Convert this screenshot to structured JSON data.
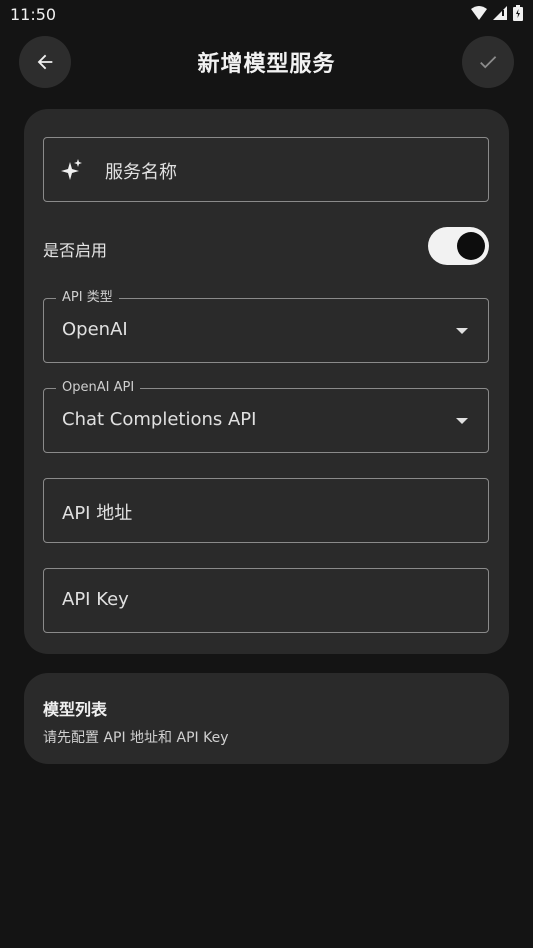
{
  "status_bar": {
    "time": "11:50"
  },
  "header": {
    "title": "新增模型服务"
  },
  "form": {
    "service_name_placeholder": "服务名称",
    "enable_label": "是否启用",
    "enabled": true,
    "api_type": {
      "label": "API 类型",
      "value": "OpenAI"
    },
    "openai_api": {
      "label": "OpenAI API",
      "value": "Chat Completions API"
    },
    "api_address_placeholder": "API 地址",
    "api_key_placeholder": "API Key"
  },
  "models": {
    "title": "模型列表",
    "hint": "请先配置 API 地址和 API Key"
  },
  "colors": {
    "background": "#141414",
    "card": "#2a2a2a",
    "outline": "#8a8a8a"
  }
}
